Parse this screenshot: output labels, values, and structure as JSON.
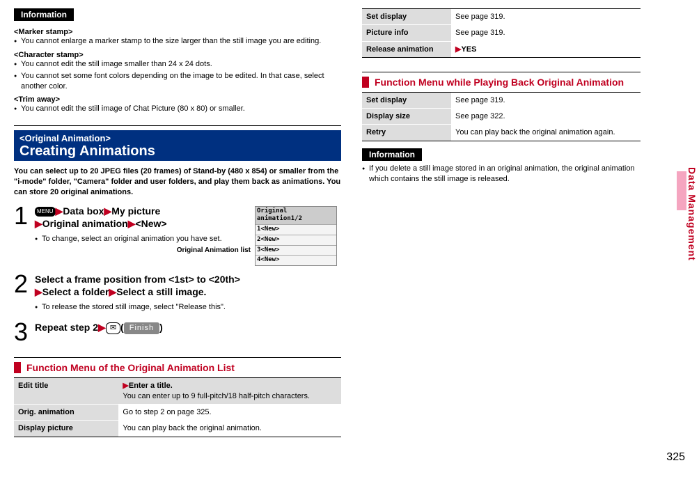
{
  "sideTab": "Data Management",
  "pageNumber": "325",
  "left": {
    "infoLabel": "Information",
    "marker": {
      "head": "<Marker stamp>",
      "items": [
        "You cannot enlarge a marker stamp to the size larger than the still image you are editing."
      ]
    },
    "character": {
      "head": "<Character stamp>",
      "items": [
        "You cannot edit the still image smaller than 24 x 24 dots.",
        "You cannot set some font colors depending on the image to be edited. In that case, select another color."
      ]
    },
    "trim": {
      "head": "<Trim away>",
      "items": [
        "You cannot edit the still image of Chat Picture (80 x 80) or smaller."
      ]
    },
    "mainHeading": {
      "small": "<Original Animation>",
      "big": "Creating Animations"
    },
    "intro": "You can select up to 20 JPEG files (20 frames) of Stand-by (480 x 854) or smaller from the \"i-mode\" folder, \"Camera\" folder and user folders, and play them back as animations. You can store 20 original animations.",
    "thumb": {
      "head": "Original animation1/2",
      "rows": [
        "1<New>",
        "2<New>",
        "3<New>",
        "4<New>"
      ],
      "caption": "Original Animation list"
    },
    "step1": {
      "menuLabel": "MENU",
      "l1a": "Data box",
      "l1b": "My picture",
      "l2a": "Original animation",
      "l2b": "<New>",
      "note": "To change, select an original animation you have set."
    },
    "step2": {
      "l1": "Select a frame position from <1st> to <20th>",
      "l2a": "Select a folder",
      "l2b": "Select a still image.",
      "note": "To release the stored still image, select \"Release this\"."
    },
    "step3": {
      "text": "Repeat step 2",
      "finish": "Finish"
    },
    "funcTitle": "Function Menu of the Original Animation List",
    "funcTable": [
      {
        "label": "Edit title",
        "val": "▶Enter a title.",
        "sub": "You can enter up to 9 full-pitch/18 half-pitch characters."
      },
      {
        "label": "Orig. animation",
        "val": "Go to step 2 on page 325."
      },
      {
        "label": "Display picture",
        "val": "You can play back the original animation."
      }
    ]
  },
  "right": {
    "topTable": [
      {
        "label": "Set display",
        "val": "See page 319."
      },
      {
        "label": "Picture info",
        "val": "See page 319."
      },
      {
        "label": "Release animation",
        "val": "▶YES",
        "valBold": true
      }
    ],
    "funcTitle2": "Function Menu while Playing Back Original Animation",
    "table2": [
      {
        "label": "Set display",
        "val": "See page 319."
      },
      {
        "label": "Display size",
        "val": "See page 322."
      },
      {
        "label": "Retry",
        "val": "You can play back the original animation again."
      }
    ],
    "infoLabel": "Information",
    "infoItems": [
      "If you delete a still image stored in an original animation, the original animation which contains the still image is released."
    ]
  }
}
